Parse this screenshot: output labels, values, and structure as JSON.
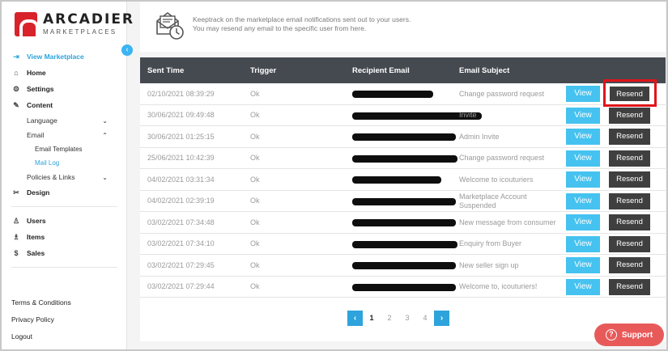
{
  "brand": {
    "name": "ARCADIER",
    "sub": "MARKETPLACES"
  },
  "header": {
    "line1": "Keeptrack on the marketplace email notifications sent out to your users.",
    "line2": "You may resend any email to the specific user from here."
  },
  "nav": {
    "view_marketplace": "View Marketplace",
    "home": "Home",
    "settings": "Settings",
    "content": "Content",
    "language": "Language",
    "email": "Email",
    "email_templates": "Email Templates",
    "mail_log": "Mail Log",
    "policies_links": "Policies & Links",
    "design": "Design",
    "users": "Users",
    "items": "Items",
    "sales": "Sales"
  },
  "footer": {
    "terms": "Terms & Conditions",
    "privacy": "Privacy Policy",
    "logout": "Logout"
  },
  "table": {
    "headers": {
      "sent_time": "Sent Time",
      "trigger": "Trigger",
      "recipient": "Recipient Email",
      "subject": "Email Subject"
    },
    "view_label": "View",
    "resend_label": "Resend",
    "rows": [
      {
        "time": "02/10/2021 08:39:29",
        "trigger": "Ok",
        "email": "",
        "subject": "Change password request"
      },
      {
        "time": "30/06/2021 09:49:48",
        "trigger": "Ok",
        "email": "",
        "subject": "Invite"
      },
      {
        "time": "30/06/2021 01:25:15",
        "trigger": "Ok",
        "email": "",
        "subject": "Admin Invite"
      },
      {
        "time": "25/06/2021 10:42:39",
        "trigger": "Ok",
        "email": "",
        "subject": "Change password request"
      },
      {
        "time": "04/02/2021 03:31:34",
        "trigger": "Ok",
        "email": "",
        "subject": "Welcome to icouturiers"
      },
      {
        "time": "04/02/2021 02:39:19",
        "trigger": "Ok",
        "email": "",
        "subject": "Marketplace Account Suspended"
      },
      {
        "time": "03/02/2021 07:34:48",
        "trigger": "Ok",
        "email": "",
        "subject": "New message from consumer"
      },
      {
        "time": "03/02/2021 07:34:10",
        "trigger": "Ok",
        "email": "",
        "subject": "Enquiry from Buyer"
      },
      {
        "time": "03/02/2021 07:29:45",
        "trigger": "Ok",
        "email": "",
        "subject": "New seller sign up"
      },
      {
        "time": "03/02/2021 07:29:44",
        "trigger": "Ok",
        "email": "",
        "subject": "Welcome to, icouturiers!"
      }
    ]
  },
  "pagination": {
    "prev": "‹",
    "next": "›",
    "pages": [
      "1",
      "2",
      "3",
      "4"
    ],
    "current": "1"
  },
  "support": {
    "label": "Support"
  },
  "colors": {
    "accent": "#2ea3dc",
    "view_btn": "#45c2f0",
    "resend_btn": "#3f3f3f",
    "header_bar": "#454a50",
    "support": "#e85a5a",
    "highlight": "#e0141a"
  }
}
